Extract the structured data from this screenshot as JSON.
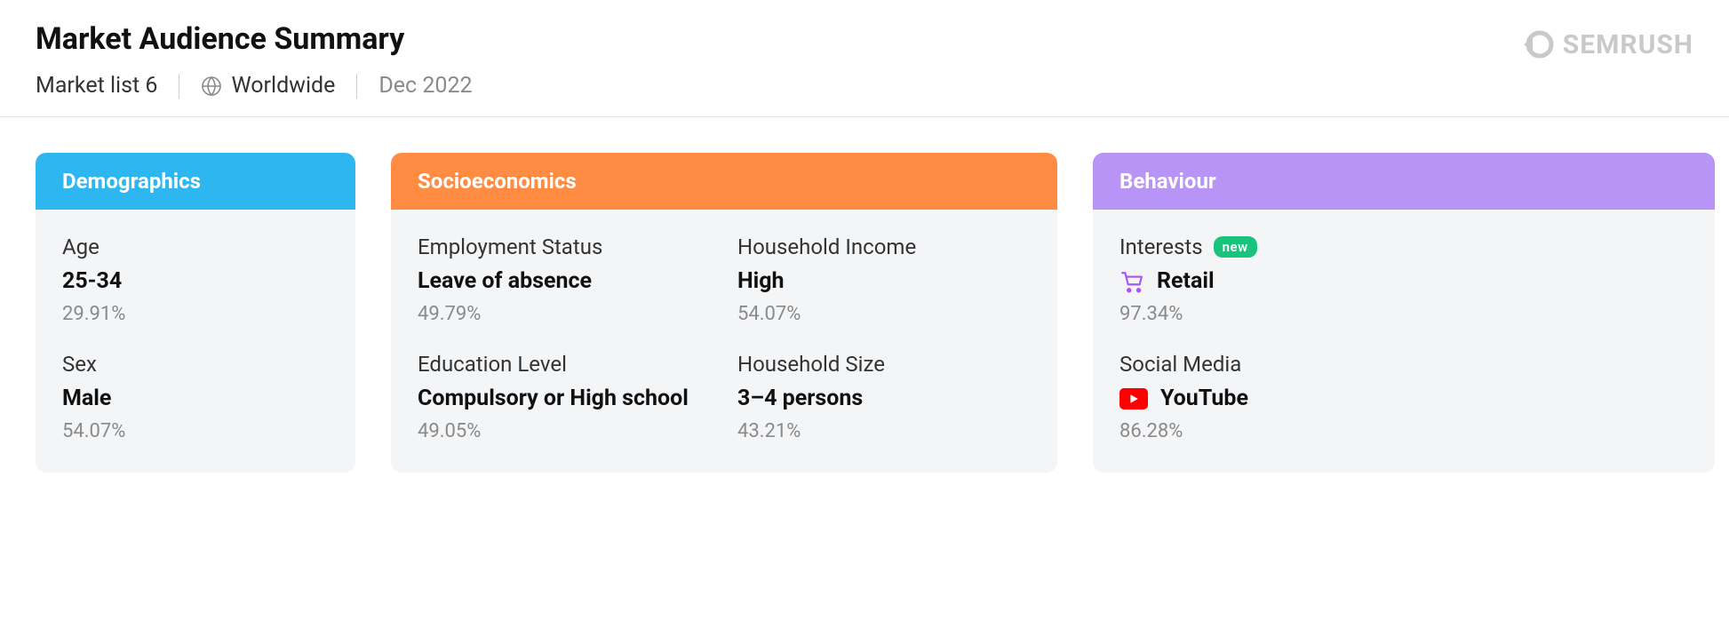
{
  "header": {
    "title": "Market Audience Summary",
    "market_list": "Market list 6",
    "region": "Worldwide",
    "date": "Dec 2022",
    "brand": "SEMRUSH"
  },
  "cards": {
    "demographics": {
      "title": "Demographics",
      "age": {
        "label": "Age",
        "value": "25-34",
        "pct": "29.91%"
      },
      "sex": {
        "label": "Sex",
        "value": "Male",
        "pct": "54.07%"
      }
    },
    "socioeconomics": {
      "title": "Socioeconomics",
      "employment": {
        "label": "Employment Status",
        "value": "Leave of absence",
        "pct": "49.79%"
      },
      "education": {
        "label": "Education Level",
        "value": "Compulsory or High school",
        "pct": "49.05%"
      },
      "income": {
        "label": "Household Income",
        "value": "High",
        "pct": "54.07%"
      },
      "size": {
        "label": "Household Size",
        "value": "3–4 persons",
        "pct": "43.21%"
      }
    },
    "behaviour": {
      "title": "Behaviour",
      "interests": {
        "label": "Interests",
        "badge": "new",
        "value": "Retail",
        "pct": "97.34%"
      },
      "social": {
        "label": "Social Media",
        "value": "YouTube",
        "pct": "86.28%"
      }
    }
  }
}
